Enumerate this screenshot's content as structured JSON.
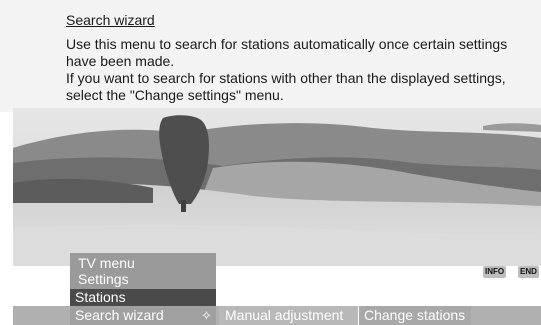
{
  "help": {
    "title": "Search wizard",
    "lines": [
      "Use this menu to search for stations automatically once certain settings have been made.",
      "If you want to search for stations with other than the displayed settings, select the \"Change settings\" menu."
    ]
  },
  "menu": {
    "title": "TV menu",
    "settings": "Settings",
    "stations": "Stations"
  },
  "submenu": {
    "items": [
      "Search wizard",
      "Manual adjustment",
      "Change stations"
    ],
    "nav_icon": "✧"
  },
  "keys": {
    "info": "INFO",
    "end": "END"
  }
}
